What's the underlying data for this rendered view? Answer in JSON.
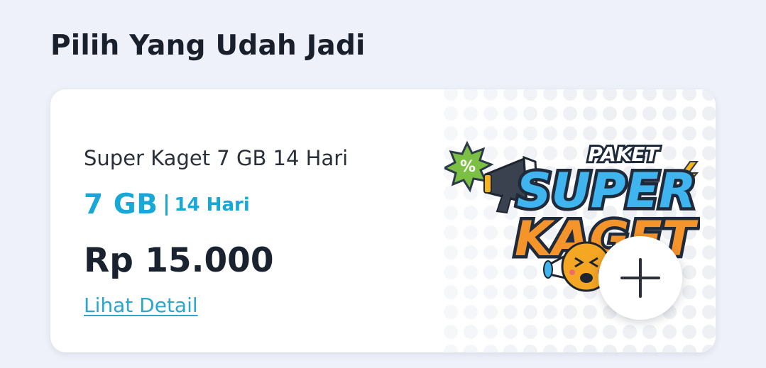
{
  "section": {
    "title": "Pilih Yang Udah Jadi"
  },
  "card": {
    "name": "Super Kaget 7 GB 14 Hari",
    "quota": "7 GB",
    "duration": "14 Hari",
    "price": "Rp 15.000",
    "detail_link": "Lihat Detail",
    "promo_logo": {
      "line1": "PAKET",
      "line2": "SUPER",
      "line3": "KAGET",
      "badge": "%"
    },
    "add_icon": "plus-icon"
  },
  "colors": {
    "background": "#eef1f9",
    "accent": "#17a8d8",
    "text": "#1a2230",
    "logo_blue": "#3fb4ee",
    "logo_orange": "#f5942a",
    "logo_green": "#7bc043",
    "logo_yellow": "#f6b51f"
  }
}
